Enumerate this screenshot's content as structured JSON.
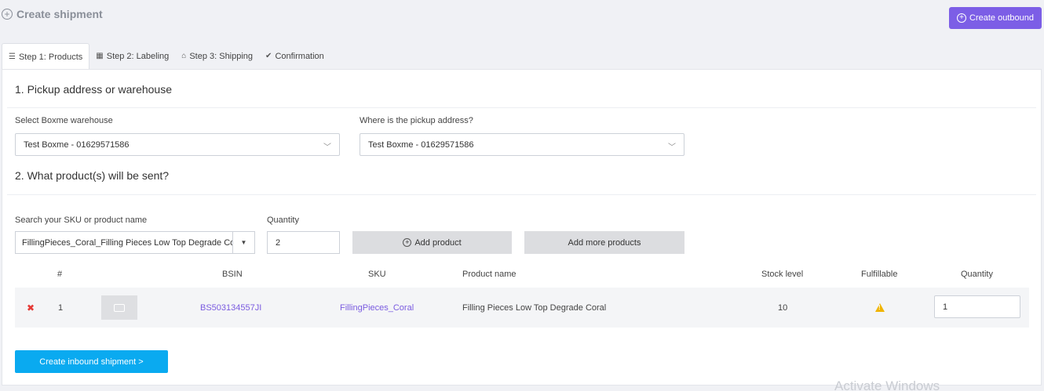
{
  "header": {
    "title": "Create shipment",
    "create_outbound_label": "Create outbound"
  },
  "tabs": [
    {
      "label": "Step 1: Products",
      "active": true
    },
    {
      "label": "Step 2: Labeling",
      "active": false
    },
    {
      "label": "Step 3: Shipping",
      "active": false
    },
    {
      "label": "Confirmation",
      "active": false
    }
  ],
  "section1": {
    "title": "1. Pickup address or warehouse",
    "warehouse_label": "Select Boxme warehouse",
    "warehouse_value": "Test Boxme - 01629571586",
    "pickup_label": "Where is the pickup address?",
    "pickup_value": "Test Boxme - 01629571586"
  },
  "section2": {
    "title": "2. What product(s) will be sent?",
    "search_label": "Search your SKU or product name",
    "search_value": "FillingPieces_Coral_Filling Pieces Low Top Degrade Coral",
    "quantity_label": "Quantity",
    "quantity_value": "2",
    "add_product_label": "Add product",
    "add_more_label": "Add more products"
  },
  "table": {
    "headers": {
      "index": "#",
      "bsin": "BSIN",
      "sku": "SKU",
      "product_name": "Product name",
      "stock_level": "Stock level",
      "fulfillable": "Fulfillable",
      "quantity": "Quantity"
    },
    "rows": [
      {
        "remove": "✖",
        "index": "1",
        "bsin": "BS503134557JI",
        "sku": "FillingPieces_Coral",
        "product_name": "Filling Pieces Low Top Degrade Coral",
        "stock_level": "10",
        "fulfillable_icon": "warning-icon",
        "quantity": "1"
      }
    ]
  },
  "footer": {
    "create_inbound_label": "Create inbound shipment >"
  },
  "watermark": "Activate Windows",
  "colors": {
    "accent_purple": "#7c5ee6",
    "accent_blue": "#0aaaf0",
    "link": "#7a5be0",
    "warning": "#f0b400",
    "remove": "#e53935"
  }
}
